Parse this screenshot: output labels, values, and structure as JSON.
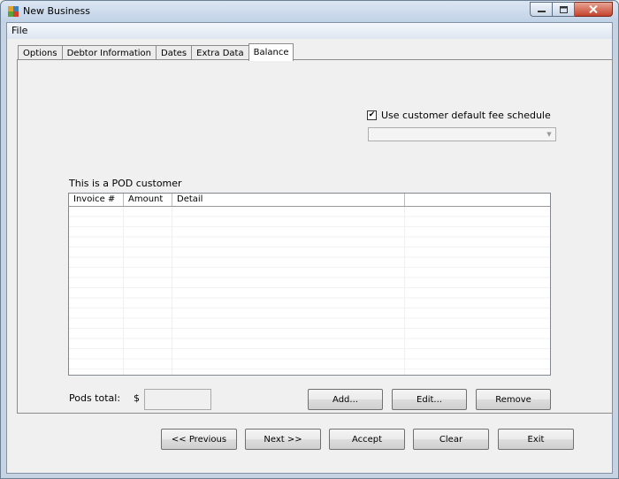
{
  "window": {
    "title": "New Business"
  },
  "menu": {
    "file": "File"
  },
  "tabs": [
    {
      "label": "Options"
    },
    {
      "label": "Debtor Information"
    },
    {
      "label": "Dates"
    },
    {
      "label": "Extra Data"
    },
    {
      "label": "Balance"
    }
  ],
  "active_tab": "Balance",
  "fee_schedule": {
    "checkbox_label": "Use customer default fee schedule",
    "checked": true,
    "check_glyph": "✔",
    "combo_value": ""
  },
  "pod_label": "This is a POD customer",
  "grid": {
    "columns": [
      "Invoice #",
      "Amount",
      "Detail",
      ""
    ],
    "rows": []
  },
  "pods_total": {
    "label": "Pods total:",
    "currency": "$",
    "value": ""
  },
  "grid_buttons": {
    "add": "Add...",
    "edit": "Edit...",
    "remove": "Remove"
  },
  "nav_buttons": {
    "previous": "<< Previous",
    "next": "Next >>",
    "accept": "Accept",
    "clear": "Clear",
    "exit": "Exit"
  },
  "colors": {
    "titlebar": "#c1d2e6",
    "close_button": "#c4432c",
    "panel": "#f0f0f0"
  }
}
